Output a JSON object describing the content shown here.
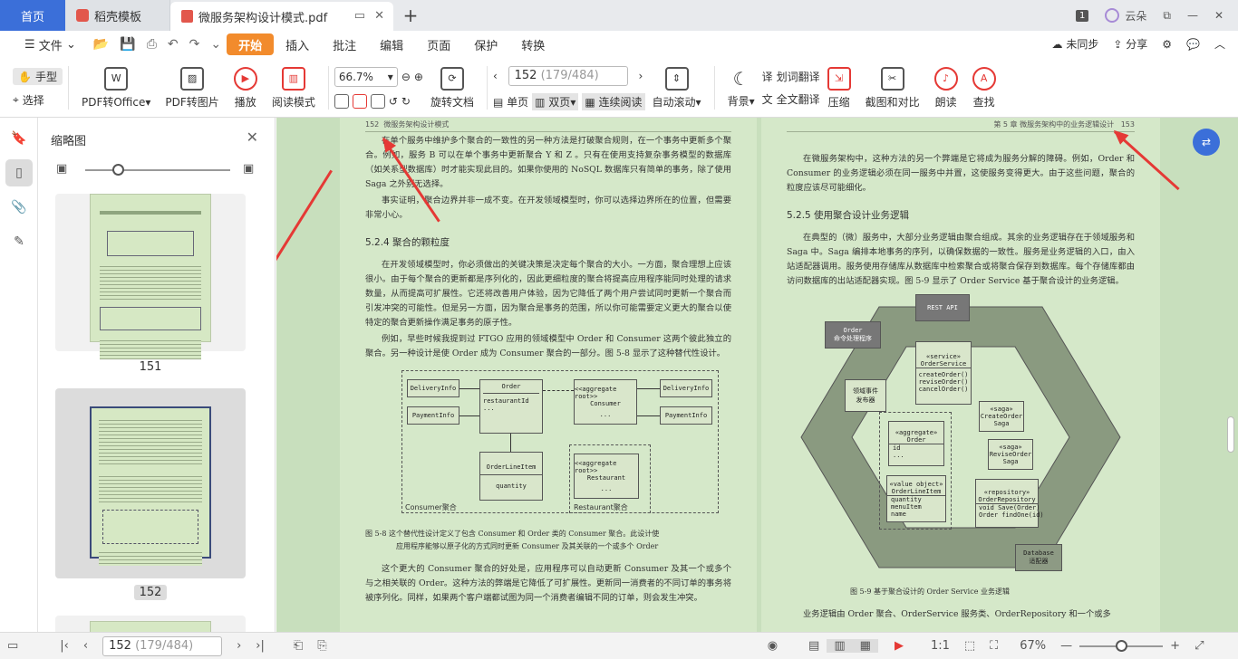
{
  "tabs": {
    "home": "首页",
    "template": "稻壳模板",
    "doc": "微服务架构设计模式.pdf",
    "user": "云朵",
    "badge": "1"
  },
  "menu": {
    "file": "文件",
    "items": [
      "开始",
      "插入",
      "批注",
      "编辑",
      "页面",
      "保护",
      "转换"
    ],
    "sync": "未同步",
    "share": "分享"
  },
  "toolbar": {
    "hand": "手型",
    "select": "选择",
    "pdf_office": "PDF转Office",
    "pdf_image": "PDF转图片",
    "play": "播放",
    "read_mode": "阅读模式",
    "zoom": "66.7%",
    "rotate": "旋转文档",
    "page": "152",
    "page_total": "(179/484)",
    "single": "单页",
    "double": "双页",
    "continuous": "连续阅读",
    "auto_scroll": "自动滚动",
    "background": "背景",
    "word_translate": "划词翻译",
    "full_translate": "全文翻译",
    "compress": "压缩",
    "screenshot": "截图和对比",
    "read_aloud": "朗读",
    "find": "查找"
  },
  "thumbs": {
    "title": "缩略图",
    "pages": [
      "151",
      "152"
    ]
  },
  "left_page": {
    "header_num": "152",
    "header_title": "微服务架构设计模式",
    "p1": "在单个服务中维护多个聚合的一致性的另一种方法是打破聚合规则，在一个事务中更新多个聚合。例如，服务 B 可以在单个事务中更新聚合 Y 和 Z 。只有在使用支持复杂事务模型的数据库（如关系型数据库）时才能实现此目的。如果你使用的 NoSQL 数据库只有简单的事务，除了使用 Saga 之外别无选择。",
    "p2": "事实证明，聚合边界并非一成不变。在开发领域模型时，你可以选择边界所在的位置，但需要非常小心。",
    "h": "5.2.4   聚合的颗粒度",
    "p3": "在开发领域模型时，你必须做出的关键决策是决定每个聚合的大小。一方面，聚合理想上应该很小。由于每个聚合的更新都是序列化的，因此更细粒度的聚合将提高应用程序能同时处理的请求数量，从而提高可扩展性。它还将改善用户体验，因为它降低了两个用户尝试同时更新一个聚合而引发冲突的可能性。但是另一方面，因为聚合是事务的范围，所以你可能需要定义更大的聚合以使特定的聚合更新操作满足事务的原子性。",
    "p4": "例如，早些时候我提到过 FTGO 应用的领域模型中 Order 和 Consumer 这两个彼此独立的聚合。另一种设计是使 Order 成为 Consumer 聚合的一部分。图 5-8 显示了这种替代性设计。",
    "fig": {
      "delivery": "DeliveryInfo",
      "order": "Order",
      "agg_root": "<<aggregate root>>",
      "consumer": "Consumer",
      "payment": "PaymentInfo",
      "rid": "restaurantId",
      "dots": "...",
      "line_item": "OrderLineItem",
      "quantity": "quantity",
      "restaurant": "Restaurant",
      "consumer_agg": "Consumer聚合",
      "restaurant_agg": "Restaurant聚合"
    },
    "cap1": "图 5-8   这个替代性设计定义了包含 Consumer 和 Order 类的 Consumer 聚合。此设计使",
    "cap2": "应用程序能够以原子化的方式同时更新 Consumer 及其关联的一个或多个 Order",
    "p5": "这个更大的 Consumer 聚合的好处是，应用程序可以自动更新 Consumer 及其一个或多个与之相关联的 Order。这种方法的弊端是它降低了可扩展性。更新同一消费者的不同订单的事务将被序列化。同样，如果两个客户端都试图为同一个消费者编辑不同的订单，则会发生冲突。"
  },
  "right_page": {
    "header_chapter": "第 5 章   微服务架构中的业务逻辑设计",
    "header_num": "153",
    "p1": "在微服务架构中，这种方法的另一个弊端是它将成为服务分解的障碍。例如，Order 和 Consumer 的业务逻辑必须在同一服务中并置，这使服务变得更大。由于这些问题，聚合的粒度应该尽可能细化。",
    "h": "5.2.5   使用聚合设计业务逻辑",
    "p2": "在典型的（微）服务中，大部分业务逻辑由聚合组成。其余的业务逻辑存在于领域服务和 Saga 中。Saga 编排本地事务的序列，以确保数据的一致性。服务是业务逻辑的入口，由入站适配器调用。服务使用存储库从数据库中检索聚合或将聚合保存到数据库。每个存储库都由访问数据库的出站适配器实现。图 5-9 显示了 Order Service 基于聚合设计的业务逻辑。",
    "fig": {
      "rest": "REST API",
      "cmd": "Order\n命令处理程序",
      "service": "«service»\nOrderService",
      "methods": "createOrder()\nreviseOrder()\ncancelOrder()",
      "event": "领域事件\n发布器",
      "saga1": "«saga»\nCreateOrder\nSaga",
      "saga2": "«saga»\nReviseOrder\nSaga",
      "aggregate": "«aggregate»\nOrder",
      "id": "id\n...",
      "vo": "«value object»\nOrderLineItem",
      "vo_fields": "quantity\nmenuItem\nname",
      "repo": "«repository»\nOrderRepository",
      "repo_m": "void Save(Order)\nOrder findOne(id)",
      "db": "Database\n适配器"
    },
    "cap": "图 5-9   基于聚合设计的 Order Service 业务逻辑",
    "p3": "业务逻辑由 Order 聚合、OrderService 服务类、OrderRepository 和一个或多"
  },
  "status": {
    "page": "152",
    "page_total": "(179/484)",
    "zoom": "67%"
  },
  "colors": {
    "accent": "#f28b2c",
    "home_tab": "#3b6fd9",
    "page_bg": "#d5e8c9",
    "annotation": "#e53935"
  }
}
